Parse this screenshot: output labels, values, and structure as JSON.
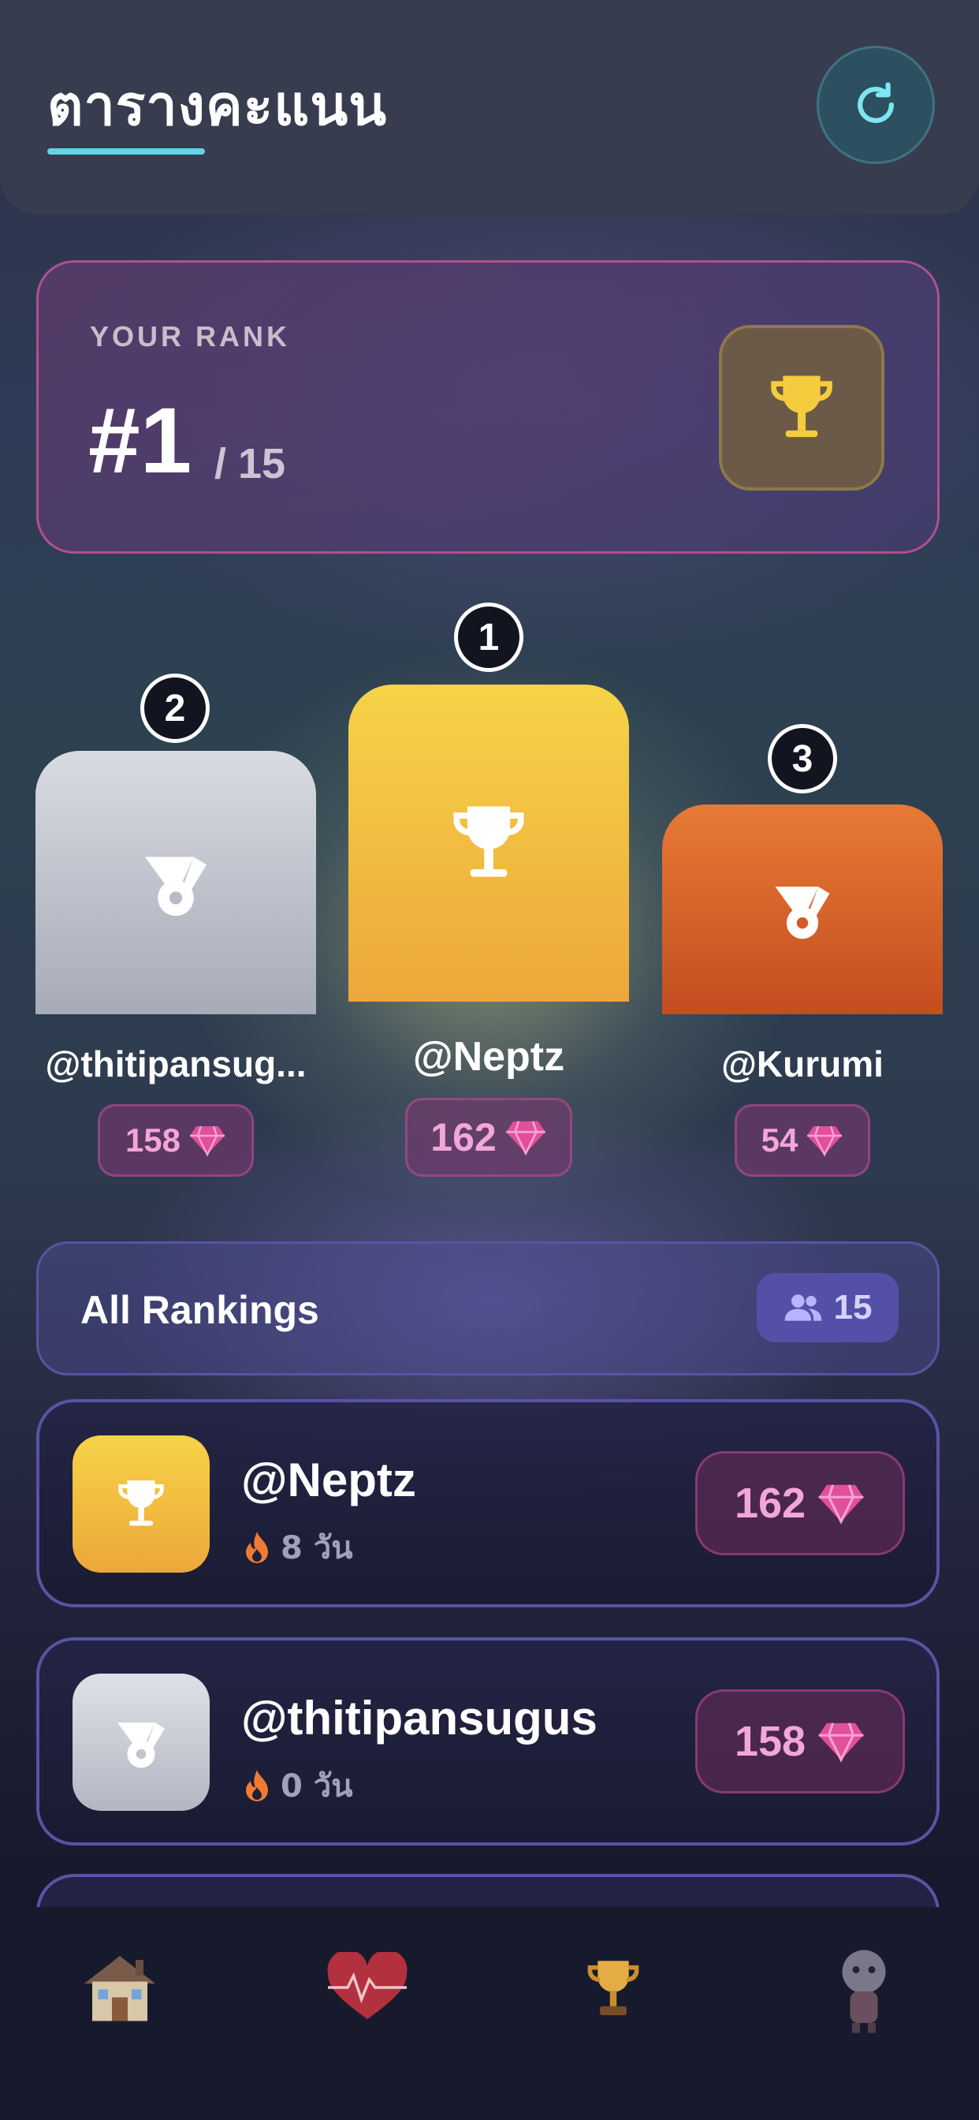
{
  "header": {
    "title": "ตารางคะแนน",
    "refresh_icon": "refresh-icon"
  },
  "your_rank": {
    "label": "YOUR RANK",
    "rank": "#1",
    "total": "/ 15",
    "icon": "trophy-icon"
  },
  "podium": [
    {
      "position": "2",
      "name": "@thitipansug...",
      "score": "158",
      "icon": "medal-icon",
      "color": "#c2c5ce"
    },
    {
      "position": "1",
      "name": "@Neptz",
      "score": "162",
      "icon": "trophy-icon",
      "color": "#f3c443"
    },
    {
      "position": "3",
      "name": "@Kurumi",
      "score": "54",
      "icon": "medal-icon",
      "color": "#d9612a"
    }
  ],
  "all_rankings": {
    "title": "All Rankings",
    "count": "15",
    "count_icon": "users-icon"
  },
  "rankings": [
    {
      "name": "@Neptz",
      "streak": "8 วัน",
      "score": "162",
      "icon": "trophy-icon"
    },
    {
      "name": "@thitipansugus",
      "streak": "0 วัน",
      "score": "158",
      "icon": "medal-icon"
    }
  ],
  "nav": [
    {
      "icon": "house-icon"
    },
    {
      "icon": "heart-icon"
    },
    {
      "icon": "trophy-icon"
    },
    {
      "icon": "character-icon"
    }
  ],
  "colors": {
    "accent_cyan": "#5fd6e6",
    "gem_pink": "#e24f9a",
    "gold": "#f3c443",
    "silver": "#c2c5ce",
    "bronze": "#d9612a"
  }
}
